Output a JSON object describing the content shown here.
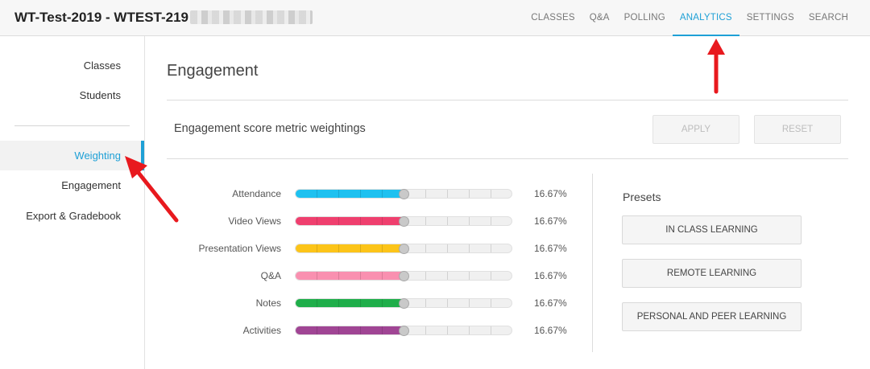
{
  "header": {
    "course_title": "WT-Test-2019 - WTEST-219",
    "nav": [
      "CLASSES",
      "Q&A",
      "POLLING",
      "ANALYTICS",
      "SETTINGS",
      "SEARCH"
    ],
    "active_nav": "ANALYTICS"
  },
  "sidebar": {
    "items": [
      {
        "label": "Classes"
      },
      {
        "label": "Students"
      },
      {
        "label": "Weighting"
      },
      {
        "label": "Engagement"
      },
      {
        "label": "Export & Gradebook"
      }
    ],
    "active_item": "Weighting"
  },
  "main": {
    "title": "Engagement",
    "section_title": "Engagement score metric weightings",
    "apply_label": "APPLY",
    "reset_label": "RESET",
    "metrics": [
      {
        "label": "Attendance",
        "percent": "16.67%",
        "value": 0.5,
        "color": "#1ec1f0"
      },
      {
        "label": "Video Views",
        "percent": "16.67%",
        "value": 0.5,
        "color": "#ef3f6e"
      },
      {
        "label": "Presentation Views",
        "percent": "16.67%",
        "value": 0.5,
        "color": "#fcc419"
      },
      {
        "label": "Q&A",
        "percent": "16.67%",
        "value": 0.5,
        "color": "#f990b0"
      },
      {
        "label": "Notes",
        "percent": "16.67%",
        "value": 0.5,
        "color": "#1fae4a"
      },
      {
        "label": "Activities",
        "percent": "16.67%",
        "value": 0.5,
        "color": "#a04594"
      }
    ],
    "presets_title": "Presets",
    "presets": [
      {
        "label": "IN CLASS LEARNING"
      },
      {
        "label": "REMOTE LEARNING"
      },
      {
        "label": "PERSONAL AND PEER LEARNING"
      }
    ]
  },
  "colors": {
    "accent": "#1ea0d6",
    "annotation_arrow": "#e8191e"
  }
}
